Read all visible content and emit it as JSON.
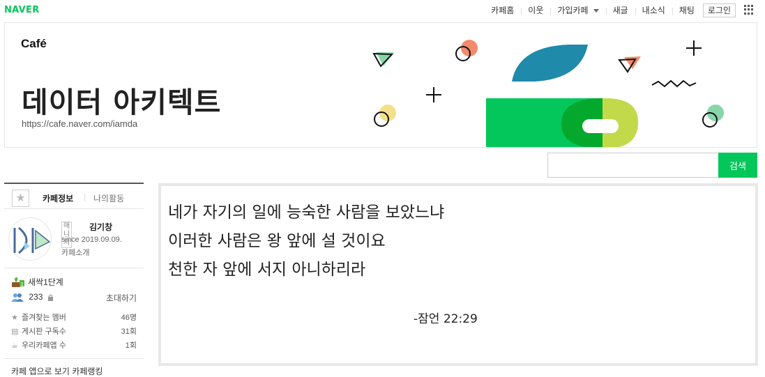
{
  "topbar": {
    "logo": "NAVER",
    "links": [
      "카페홈",
      "이웃",
      "가입카페",
      "새글",
      "내소식",
      "채팅"
    ],
    "login": "로그인"
  },
  "banner": {
    "cafe_label": "Café",
    "cafe_name": "데이터 아키텍트",
    "cafe_url": "https://cafe.naver.com/iamda",
    "colors": {
      "green": "#03c75a",
      "dark_green": "#03a82c",
      "lime": "#c2d94a",
      "teal": "#1f8aaa",
      "coral": "#f28b6b",
      "yellow": "#f4e08a",
      "mint": "#88d6a8"
    }
  },
  "search": {
    "placeholder": "",
    "button": "검색"
  },
  "sidebar": {
    "tab_info": "카페정보",
    "tab_activity": "나의활동",
    "manager_badge": "매니저",
    "manager_name": "김기창",
    "since": "since 2019.09.09.",
    "intro": "카페소개",
    "level": "새싹1단계",
    "member_count": "233",
    "invite": "초대하기",
    "stats": [
      {
        "label": "즐겨찾는 멤버",
        "value": "46명",
        "icon": "star-icon"
      },
      {
        "label": "게시판 구독수",
        "value": "31회",
        "icon": "rss-icon"
      },
      {
        "label": "우리카페앱 수",
        "value": "1회",
        "icon": "app-icon"
      }
    ],
    "cut_text": "카페 앱으로 보기  카페랭킹"
  },
  "main": {
    "lines": [
      "네가 자기의 일에 능숙한 사람을 보았느냐",
      "이러한 사람은 왕 앞에 설 것이요",
      "천한 자 앞에 서지 아니하리라"
    ],
    "reference": "-잠언 22:29"
  }
}
